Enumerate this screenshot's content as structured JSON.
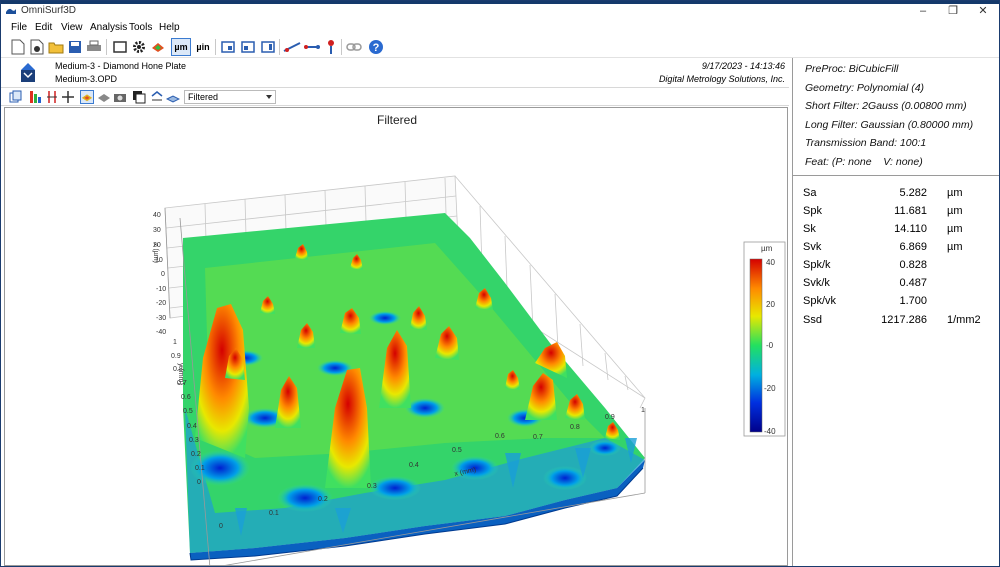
{
  "window": {
    "title": "OmniSurf3D"
  },
  "menu": [
    "File",
    "Edit",
    "View",
    "Analysis",
    "Tools",
    "Help"
  ],
  "toolbar": {
    "unit_um": "µm",
    "unit_uin": "µin"
  },
  "header": {
    "sample_name": "Medium-3 - Diamond Hone Plate",
    "file_name": "Medium-3.OPD",
    "datetime": "9/17/2023 - 14:13:46",
    "company": "Digital Metrology Solutions, Inc."
  },
  "plot_toolbar": {
    "view_select": "Filtered"
  },
  "plot": {
    "title": "Filtered",
    "z_axis_label": "z (µm)",
    "y_axis_label": "y (mm)",
    "x_axis_label": "x (mm)",
    "z_ticks": [
      "40",
      "30",
      "20",
      "10",
      "0",
      "-10",
      "-20",
      "-30",
      "-40"
    ],
    "y_ticks": [
      "1",
      "0.9",
      "0.8",
      "0.7",
      "0.6",
      "0.5",
      "0.4",
      "0.3",
      "0.2",
      "0.1",
      "0"
    ],
    "x_ticks": [
      "0",
      "0.1",
      "0.2",
      "0.3",
      "0.4",
      "0.5",
      "0.6",
      "0.7",
      "0.8",
      "0.9",
      "1"
    ],
    "colorbar": {
      "unit": "µm",
      "labels": [
        "40",
        "20",
        "-0",
        "-20",
        "-40"
      ],
      "colors": [
        "#d40000",
        "#ff8a00",
        "#e8e800",
        "#22e060",
        "#00b0e0",
        "#0030e0",
        "#00008a"
      ]
    }
  },
  "filters": {
    "preproc": "PreProc: BiCubicFill",
    "geometry": "Geometry: Polynomial (4)",
    "short_filter": "Short Filter: 2Gauss (0.00800 mm)",
    "long_filter": "Long Filter: Gaussian (0.80000 mm)",
    "transmission_band": "Transmission Band: 100:1",
    "feat": "Feat: (P: none    V: none)"
  },
  "parameters": [
    {
      "name": "Sa",
      "value": "5.282",
      "unit": "µm"
    },
    {
      "name": "Spk",
      "value": "11.681",
      "unit": "µm"
    },
    {
      "name": "Sk",
      "value": "14.110",
      "unit": "µm"
    },
    {
      "name": "Svk",
      "value": "6.869",
      "unit": "µm"
    },
    {
      "name": "Spk/k",
      "value": "0.828",
      "unit": ""
    },
    {
      "name": "Svk/k",
      "value": "0.487",
      "unit": ""
    },
    {
      "name": "Spk/vk",
      "value": "1.700",
      "unit": ""
    },
    {
      "name": "Ssd",
      "value": "1217.286",
      "unit": "1/mm2"
    }
  ]
}
